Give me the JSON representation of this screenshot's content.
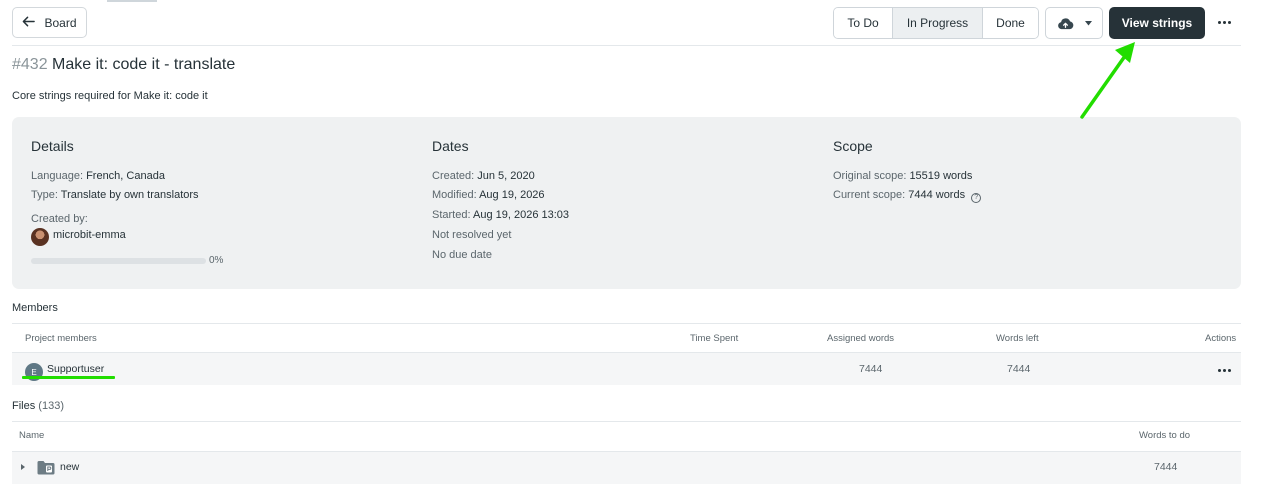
{
  "header": {
    "back_label": "Board",
    "statuses": [
      "To Do",
      "In Progress",
      "Done"
    ],
    "active_status": "In Progress",
    "view_strings_label": "View strings"
  },
  "task": {
    "number": "#432",
    "title": "Make it: code it - translate",
    "description": "Core strings required for Make it: code it"
  },
  "details": {
    "heading": "Details",
    "language_label": "Language:",
    "language_value": "French, Canada",
    "type_label": "Type:",
    "type_value": "Translate by own translators",
    "created_by_label": "Created by:",
    "created_by_value": "microbit-emma",
    "progress_label": "0%",
    "progress_fraction": 0
  },
  "dates": {
    "heading": "Dates",
    "created_label": "Created:",
    "created_value": "Jun 5, 2020",
    "modified_label": "Modified:",
    "modified_value": "Aug 19, 2026",
    "started_label": "Started:",
    "started_value": "Aug 19, 2026 13:03",
    "resolved_text": "Not resolved yet",
    "due_text": "No due date"
  },
  "scope": {
    "heading": "Scope",
    "original_label": "Original scope:",
    "original_value": "15519 words",
    "current_label": "Current scope:",
    "current_value": "7444 words"
  },
  "members": {
    "heading": "Members",
    "columns": [
      "Project members",
      "Time Spent",
      "Assigned words",
      "Words left",
      "Actions"
    ],
    "rows": [
      {
        "avatar_initial": "E",
        "name": "Supportuser",
        "time_spent": "",
        "assigned_words": "7444",
        "words_left": "7444"
      }
    ]
  },
  "files": {
    "heading": "Files",
    "count": "(133)",
    "columns": [
      "Name",
      "Words to do"
    ],
    "rows": [
      {
        "name": "new",
        "words_to_do": "7444"
      }
    ]
  },
  "colors": {
    "primary_button": "#263238",
    "annotation_arrow": "#22dd00",
    "panel_bg": "#eff1f2"
  },
  "icons": {
    "back": "arrow-left-icon",
    "upload": "cloud-upload-icon",
    "dropdown": "chevron-down-icon",
    "more": "more-horizontal-icon",
    "folder": "folder-icon",
    "expand": "caret-right-icon",
    "help": "question-circle-icon"
  }
}
